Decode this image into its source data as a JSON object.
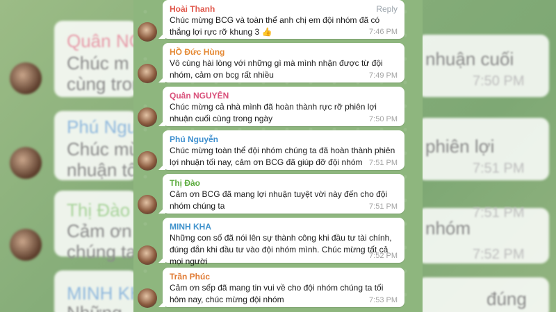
{
  "messages": [
    {
      "sender": "Hoài Thanh",
      "color": "#e0564a",
      "text": "Chúc mừng BCG và toàn thể anh chị em đội nhóm đã có thắng lợi rực rỡ khung 3",
      "emoji": "👍",
      "time": "7:46 PM",
      "reply": "Reply"
    },
    {
      "sender": "HỒ Đức Hùng",
      "color": "#e58a36",
      "text": "Vô cùng hài lòng với những gì mà mình nhận được từ đội nhóm, cảm ơn bcg rất nhiều",
      "time": "7:49 PM"
    },
    {
      "sender": "Quân NGUYỄN",
      "color": "#d9507a",
      "text": "Chúc mừng cả nhà mình đã hoàn thành rực rỡ phiên lợi nhuận cuối cùng trong ngày",
      "time": "7:50 PM"
    },
    {
      "sender": "Phú Nguyễn",
      "color": "#3d8fcf",
      "text": "Chúc mừng toàn thể đội nhóm chúng ta đã hoàn thành phiên lợi nhuận tối nay, cảm ơn BCG đã giúp đỡ đội nhóm",
      "time": "7:51 PM"
    },
    {
      "sender": "Thị Đào",
      "color": "#5aab3c",
      "text": "Cảm ơn BCG đã mang lợi nhuận tuyệt vời này đến cho đội nhóm chúng ta",
      "time": "7:51 PM"
    },
    {
      "sender": "MINH KHA",
      "color": "#3f92cc",
      "text": "Những con số đã nói lên sự thành công khi đầu tư tài chính, đúng đắn khi đầu tư vào đội nhóm mình. Chúc mừng tất cả mọi người",
      "time": "7:52 PM"
    },
    {
      "sender": "Trần Phúc",
      "color": "#e07a33",
      "text": "Cảm ơn sếp  đã mang tin vui về cho đội nhóm chúng ta tối hôm nay, chúc mừng đội nhóm",
      "time": "7:53 PM"
    }
  ],
  "background": {
    "left_texts": [
      "Quân NG",
      "Chúc m",
      "cùng trong",
      "Phú Nguy",
      "Chúc mừ",
      "nhuận tối",
      "Thị Đào",
      "Cảm ơn B",
      "chúng ta",
      "MINH KH",
      "Những"
    ],
    "right_texts": [
      "nhuận cuối",
      "7:50 PM",
      "phiên lợi",
      "7:51 PM",
      "nhóm",
      "7:51 PM",
      "7:52 PM",
      "đúng"
    ]
  }
}
